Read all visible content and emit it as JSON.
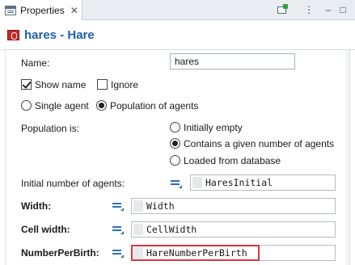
{
  "tab": {
    "label": "Properties",
    "close": "✕"
  },
  "toolbar": {
    "menu_glyph": "⋮",
    "minimize_glyph": "–",
    "maximize_glyph": "□"
  },
  "title": "hares - Hare",
  "fields": {
    "name_label": "Name:",
    "name_value": "hares",
    "show_name_label": "Show name",
    "show_name_checked": true,
    "ignore_label": "Ignore",
    "ignore_checked": false,
    "single_agent_label": "Single agent",
    "population_label": "Population of agents",
    "population_is_label": "Population is:",
    "population_options": [
      "Initially empty",
      "Contains a given number of agents",
      "Loaded from database"
    ],
    "population_selected": 1,
    "initial_number_label": "Initial number of agents:",
    "initial_number_value": "HaresInitial",
    "width_label": "Width:",
    "width_value": "Width",
    "cell_width_label": "Cell width:",
    "cell_width_value": "CellWidth",
    "number_per_birth_label": "NumberPerBirth:",
    "number_per_birth_value": "HareNumberPerBirth"
  },
  "colors": {
    "title": "#1f5ea8",
    "highlight_border": "#d9363e",
    "equals_icon": "#2f6fb3"
  }
}
